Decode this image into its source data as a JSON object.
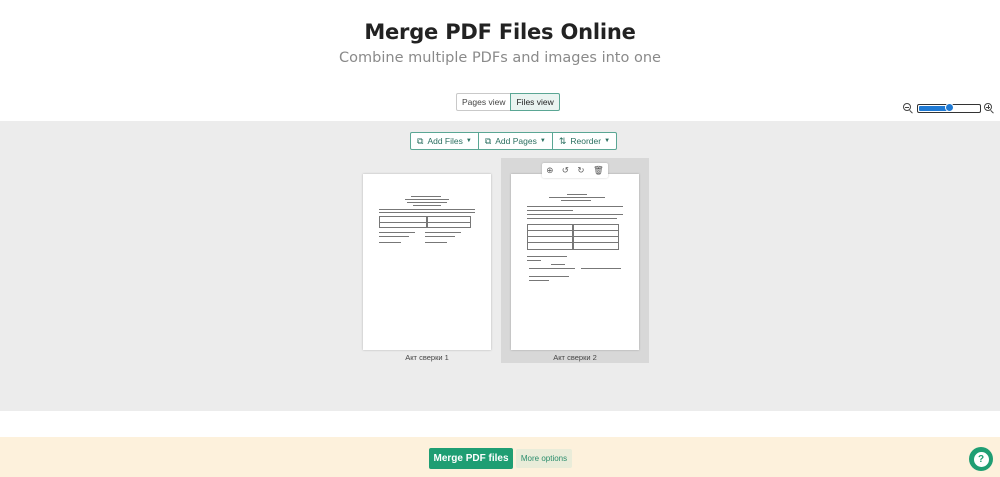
{
  "header": {
    "title": "Merge PDF Files Online",
    "subtitle": "Combine multiple PDFs and images into one"
  },
  "view_toggle": {
    "pages_label": "Pages view",
    "files_label": "Files view",
    "active": "Files view"
  },
  "zoom": {
    "level_fraction": 0.5
  },
  "toolbar": {
    "add_files_label": "Add Files",
    "add_pages_label": "Add Pages",
    "reorder_label": "Reorder"
  },
  "files": [
    {
      "name": "Акт сверки 1",
      "selected": false
    },
    {
      "name": "Акт сверки 2",
      "selected": true
    }
  ],
  "card_tools": [
    "zoom-in-icon",
    "rotate-left-icon",
    "rotate-right-icon",
    "trash-icon"
  ],
  "footer": {
    "merge_label": "Merge PDF files",
    "more_options_label": "More options"
  },
  "colors": {
    "accent": "#1f9e73",
    "footer_bg": "#fdf1dc",
    "workspace_bg": "#ececec",
    "slider": "#1f7ad4"
  }
}
